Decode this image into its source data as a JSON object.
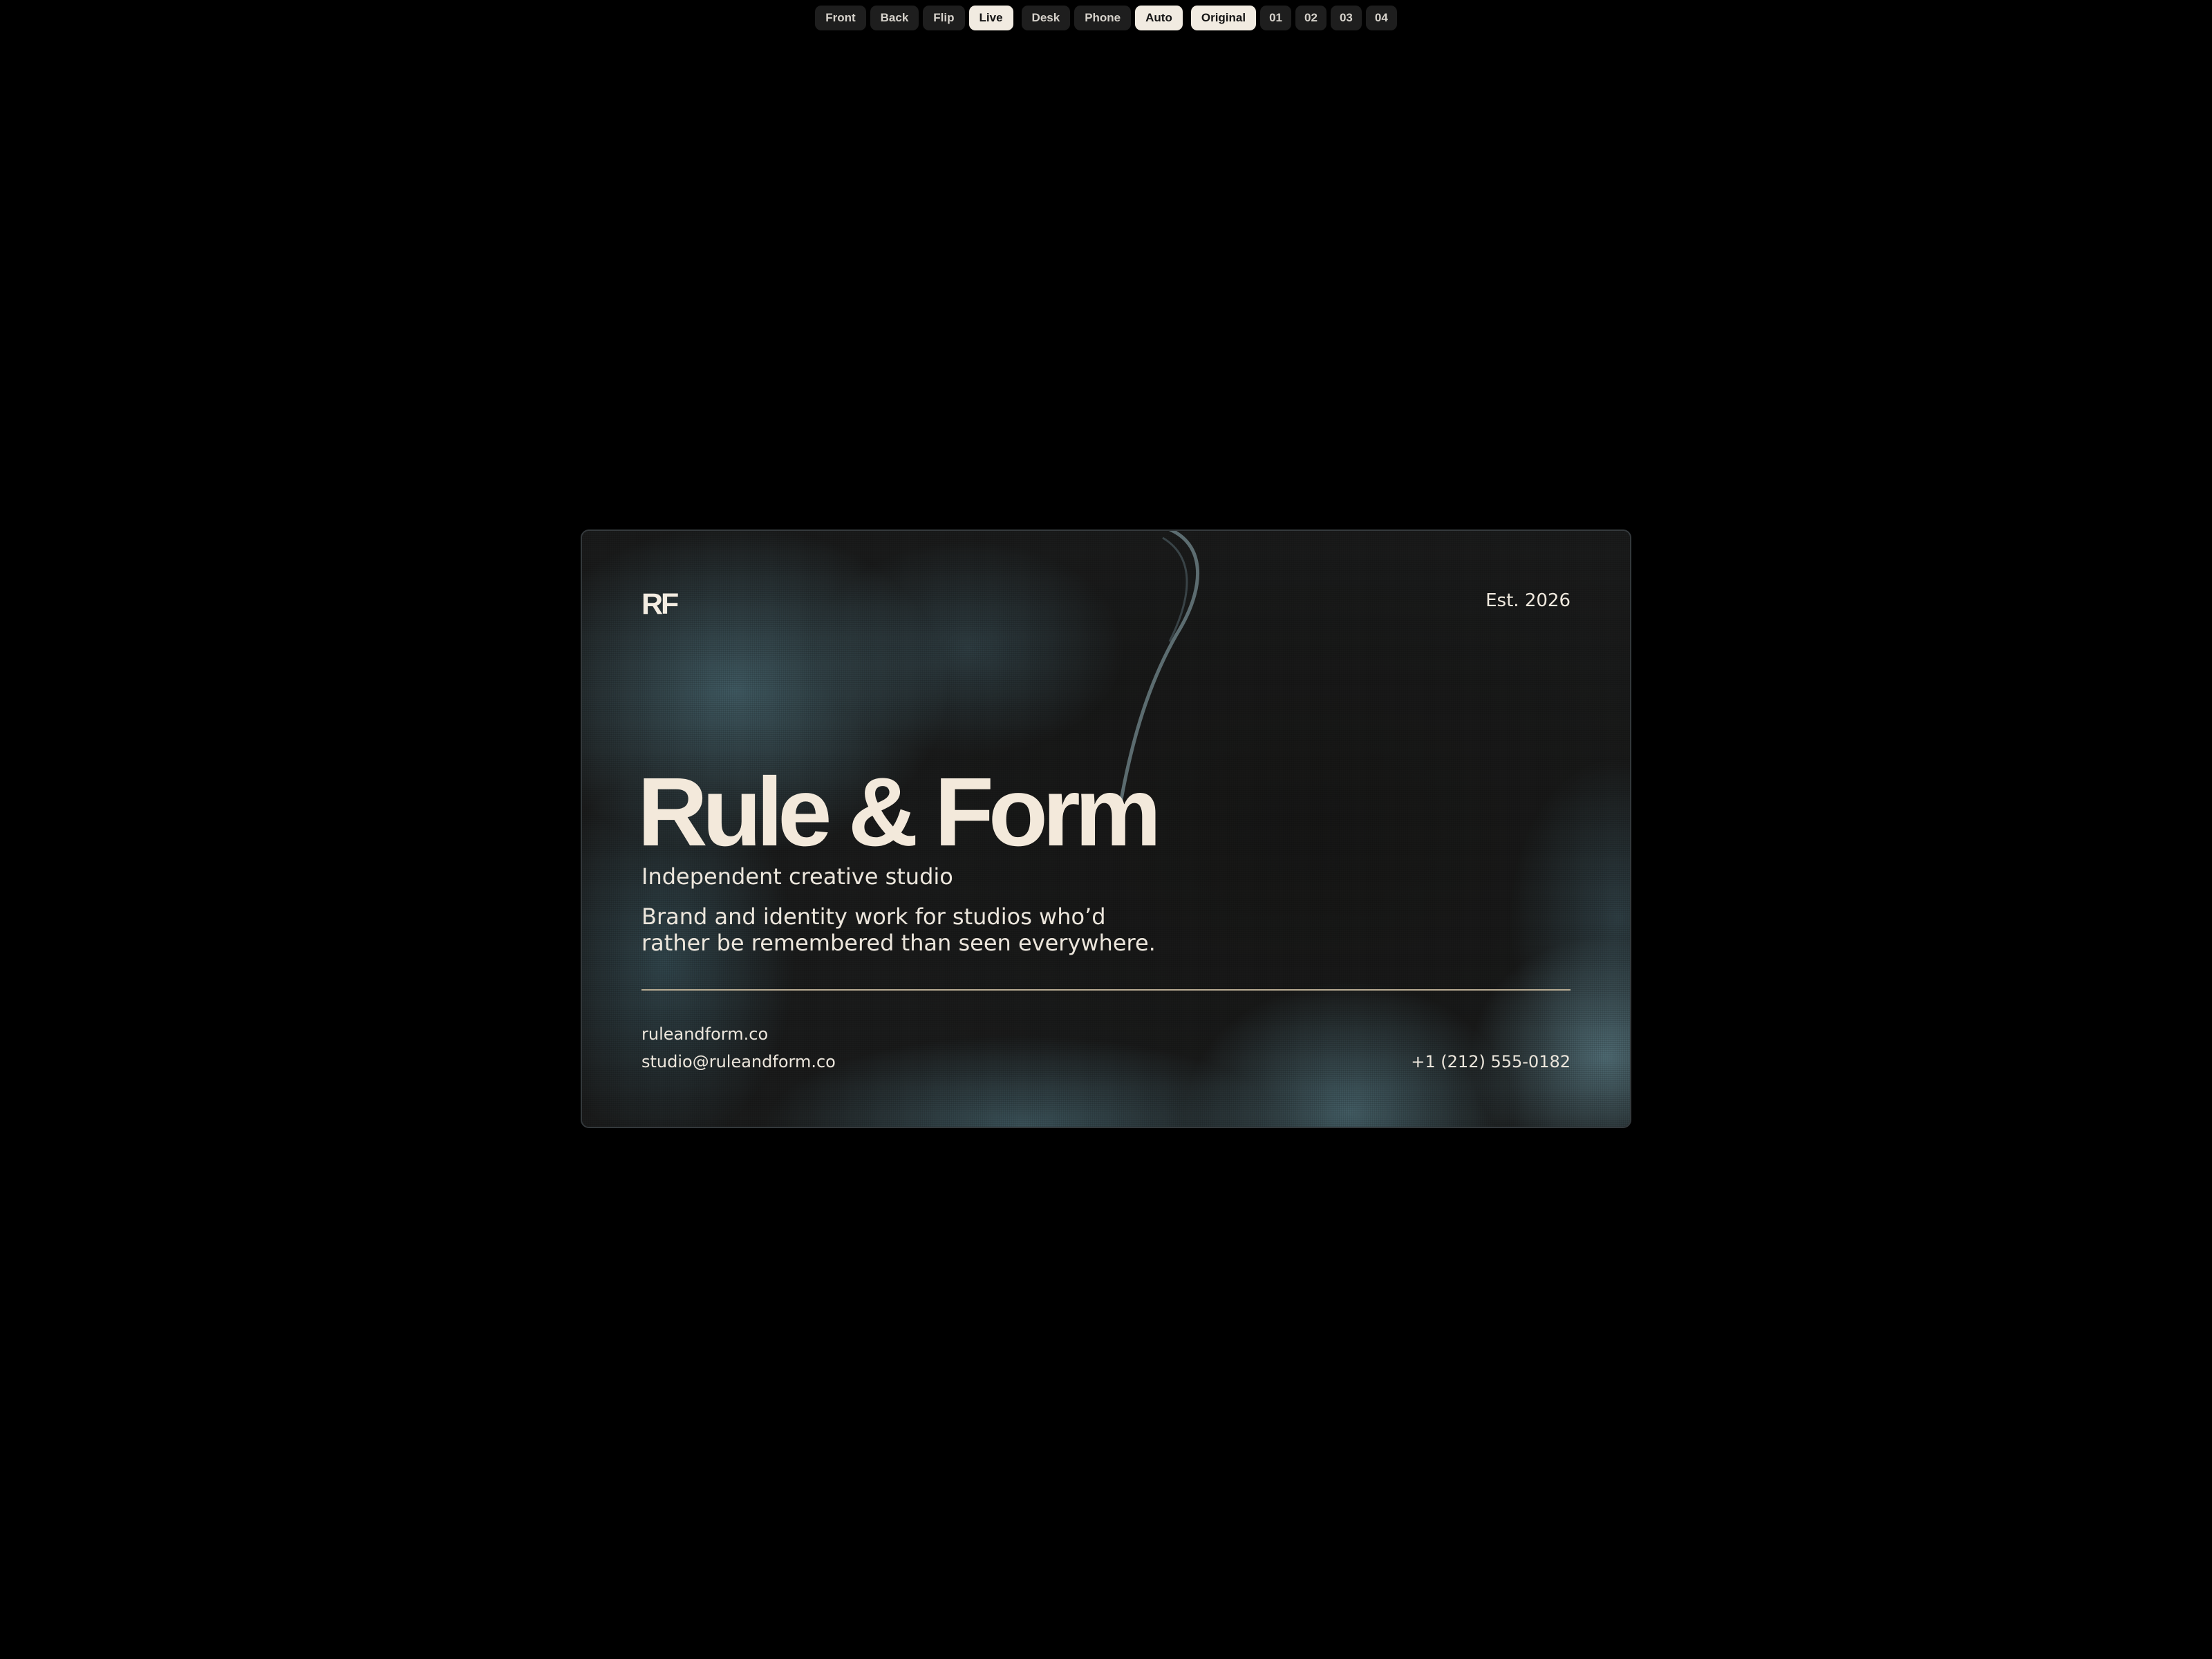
{
  "colors": {
    "page_background": "#000000",
    "button_background": "#1e1e1e",
    "button_text": "#d6d2cb",
    "active_button_background": "#f1ebe1",
    "active_button_text": "#141414",
    "card_dark": "#1a1b1b",
    "card_smoke": "#48686f",
    "title_text": "#f3e9db",
    "divider": "#b8ab92"
  },
  "toolbar": {
    "side_buttons": [
      {
        "label": "Front",
        "active": false
      },
      {
        "label": "Back",
        "active": false
      },
      {
        "label": "Flip",
        "active": false
      },
      {
        "label": "Live",
        "active": true
      }
    ],
    "view_buttons": [
      {
        "label": "Desk",
        "active": false
      },
      {
        "label": "Phone",
        "active": false
      },
      {
        "label": "Auto",
        "active": true
      }
    ],
    "variant_buttons": [
      {
        "label": "Original",
        "active": true
      },
      {
        "label": "01",
        "active": false
      },
      {
        "label": "02",
        "active": false
      },
      {
        "label": "03",
        "active": false
      },
      {
        "label": "04",
        "active": false
      }
    ]
  },
  "card": {
    "monogram": "RF",
    "established": "Est. 2026",
    "name": "Rule & Form",
    "tagline": "Independent creative studio",
    "description": "Brand and identity work for studios who’d rather be remembered than seen everywhere.",
    "website": "ruleandform.co",
    "email": "studio@ruleandform.co",
    "phone": "+1 (212) 555-0182"
  }
}
